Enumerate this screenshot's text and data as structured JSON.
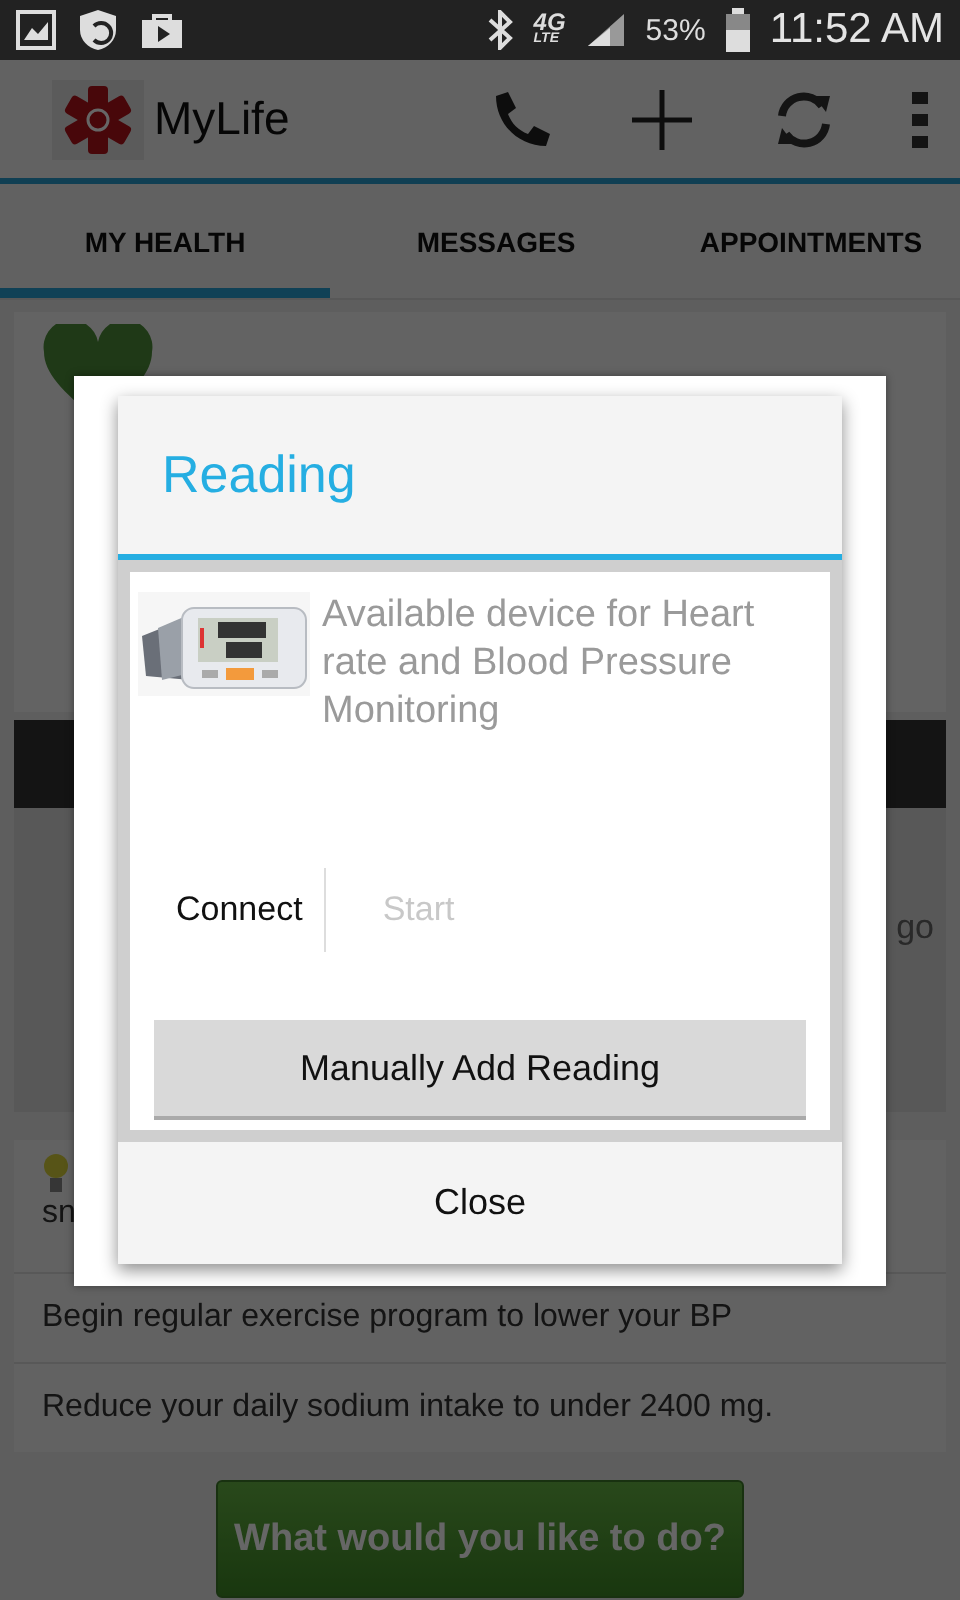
{
  "status_bar": {
    "network": "4G",
    "network_sub": "LTE",
    "battery": "53%",
    "time": "11:52 AM"
  },
  "app_bar": {
    "title": "MyLife"
  },
  "tabs": [
    {
      "label": "MY HEALTH",
      "selected": true
    },
    {
      "label": "MESSAGES",
      "selected": false
    },
    {
      "label": "APPOINTMENTS",
      "selected": false
    }
  ],
  "background": {
    "card_fragment": "go",
    "tip_fragment": "sn",
    "tips": [
      "Begin  regular exercise program to lower your BP",
      "Reduce your daily sodium intake to under 2400 mg."
    ],
    "action_button": "What would you like to do?"
  },
  "dialog": {
    "title": "Reading",
    "device": {
      "kind": "picture",
      "description": "Available device for Heart rate and Blood Pressure Monitoring"
    },
    "actions": [
      {
        "label": "Connect",
        "disabled": false
      },
      {
        "label": "Start",
        "disabled": true
      }
    ],
    "manual_button": "Manually Add Reading",
    "close": "Close"
  }
}
